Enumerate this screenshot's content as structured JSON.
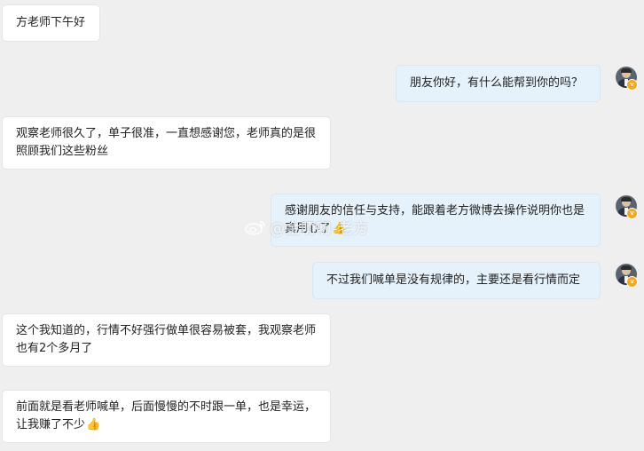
{
  "messages": [
    {
      "side": "left",
      "text": "方老师下午好"
    },
    {
      "side": "right",
      "text": "朋友你好，有什么能帮到你的吗？"
    },
    {
      "side": "left",
      "text": "观察老师很久了，单子很准，一直想感谢您，老师真的是很照顾我们这些粉丝"
    },
    {
      "side": "right",
      "text": "感谢朋友的信任与支持，能跟着老方微博去操作说明你也是真用心了",
      "emoji": "👍"
    },
    {
      "side": "right",
      "text": "不过我们喊单是没有规律的，主要还是看行情而定"
    },
    {
      "side": "left",
      "text": "这个我知道的，行情不好强行做单很容易被套，我观察老师也有2个多月了"
    },
    {
      "side": "left",
      "text": "前面就是看老师喊单，后面慢慢的不时跟一单，也是幸运，让我赚了不少",
      "emoji": "👍"
    }
  ],
  "avatar_badge": "v",
  "watermark": {
    "text": "@金叨叨-老方",
    "icon": "weibo-logo-icon"
  },
  "colors": {
    "background": "#efefef",
    "left_bubble": "#ffffff",
    "right_bubble": "#e5f1fb",
    "badge": "#f5a623"
  }
}
